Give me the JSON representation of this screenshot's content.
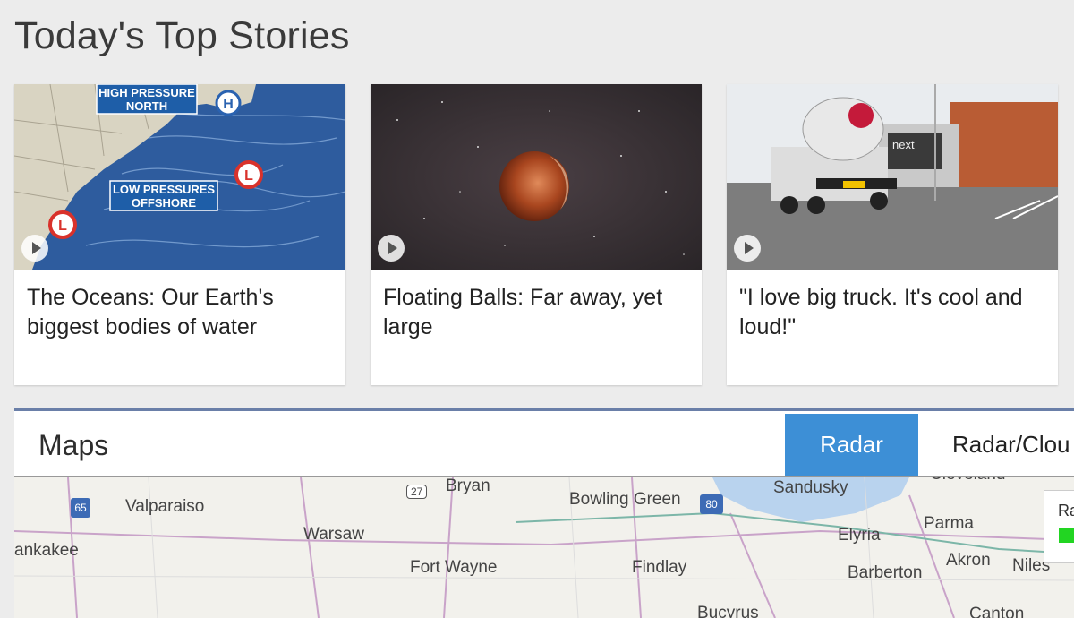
{
  "section_title": "Today's Top Stories",
  "stories": [
    {
      "headline": "The Oceans: Our Earth's biggest bodies of water",
      "overlay_labels": [
        "HIGH PRESSURE",
        "NORTH",
        "LOW PRESSURES",
        "OFFSHORE"
      ],
      "icon": "weather-map-image"
    },
    {
      "headline": "Floating Balls: Far away, yet large",
      "icon": "moon-image"
    },
    {
      "headline": "\"I love big truck. It's cool and loud!\"",
      "sign_text": "next",
      "icon": "truck-image"
    }
  ],
  "maps": {
    "title": "Maps",
    "tabs": [
      "Radar",
      "Radar/Clou"
    ],
    "active_tab": "Radar",
    "accent_color": "#3d8fd6",
    "legend_label": "Ra",
    "legend_color": "#22d522",
    "shields": [
      "65",
      "27",
      "80"
    ],
    "cities": [
      "Valparaiso",
      "ankakee",
      "Warsaw",
      "Bryan",
      "Fort Wayne",
      "Bowling Green",
      "Sandusky",
      "Findlay",
      "Elyria",
      "Parma",
      "Barberton",
      "Akron",
      "Niles",
      "Bucyrus",
      "Canton",
      "Cleveland"
    ]
  }
}
